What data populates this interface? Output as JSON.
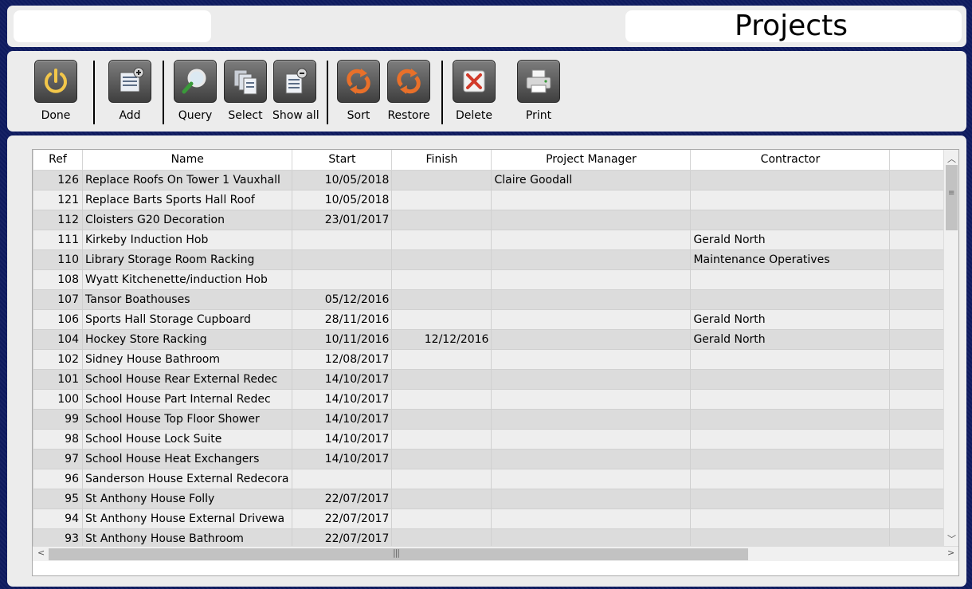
{
  "header": {
    "title": "Projects",
    "left_box_text": ""
  },
  "toolbar": {
    "done": "Done",
    "add": "Add",
    "query": "Query",
    "select": "Select",
    "show_all": "Show all",
    "sort": "Sort",
    "restore": "Restore",
    "delete": "Delete",
    "print": "Print"
  },
  "table": {
    "columns": [
      "Ref",
      "Name",
      "Start",
      "Finish",
      "Project Manager",
      "Contractor",
      ""
    ],
    "rows": [
      [
        "126",
        "Replace Roofs On Tower 1 Vauxhall",
        "10/05/2018",
        "",
        "Claire Goodall",
        "",
        ""
      ],
      [
        "121",
        "Replace Barts Sports Hall Roof",
        "10/05/2018",
        "",
        "",
        "",
        ""
      ],
      [
        "112",
        "Cloisters G20 Decoration",
        "23/01/2017",
        "",
        "",
        "",
        ""
      ],
      [
        "111",
        "Kirkeby Induction Hob",
        "",
        "",
        "",
        "Gerald North",
        ""
      ],
      [
        "110",
        "Library Storage Room Racking",
        "",
        "",
        "",
        "Maintenance Operatives",
        ""
      ],
      [
        "108",
        "Wyatt Kitchenette/induction Hob",
        "",
        "",
        "",
        "",
        ""
      ],
      [
        "107",
        "Tansor Boathouses",
        "05/12/2016",
        "",
        "",
        "",
        ""
      ],
      [
        "106",
        "Sports Hall Storage Cupboard",
        "28/11/2016",
        "",
        "",
        "Gerald North",
        ""
      ],
      [
        "104",
        "Hockey Store Racking",
        "10/11/2016",
        "12/12/2016",
        "",
        "Gerald North",
        ""
      ],
      [
        "102",
        "Sidney House Bathroom",
        "12/08/2017",
        "",
        "",
        "",
        ""
      ],
      [
        "101",
        "School House Rear External Redec",
        "14/10/2017",
        "",
        "",
        "",
        ""
      ],
      [
        "100",
        "School House Part Internal Redec",
        "14/10/2017",
        "",
        "",
        "",
        ""
      ],
      [
        "99",
        "School House Top Floor Shower",
        "14/10/2017",
        "",
        "",
        "",
        ""
      ],
      [
        "98",
        "School House Lock Suite",
        "14/10/2017",
        "",
        "",
        "",
        ""
      ],
      [
        "97",
        "School House Heat Exchangers",
        "14/10/2017",
        "",
        "",
        "",
        ""
      ],
      [
        "96",
        "Sanderson House External Redecora",
        "",
        "",
        "",
        "",
        ""
      ],
      [
        "95",
        "St Anthony House Folly",
        "22/07/2017",
        "",
        "",
        "",
        ""
      ],
      [
        "94",
        "St Anthony House External Drivewa",
        "22/07/2017",
        "",
        "",
        "",
        ""
      ],
      [
        "93",
        "St Anthony House Bathroom",
        "22/07/2017",
        "",
        "",
        "",
        ""
      ]
    ]
  },
  "colors": {
    "background": "#0e1a5e",
    "panel": "#ececec",
    "row_dark": "#dcdcdc",
    "row_light": "#eeeeee"
  }
}
